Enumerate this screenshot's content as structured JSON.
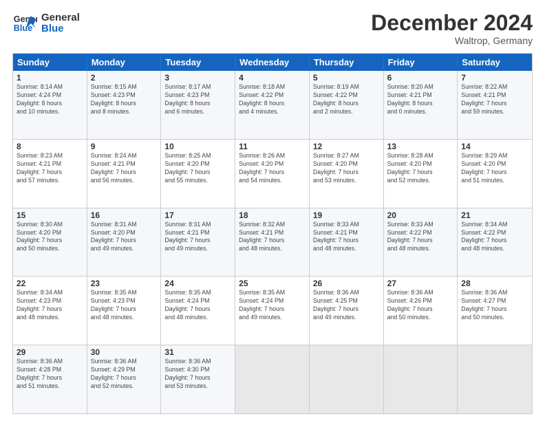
{
  "logo": {
    "line1": "General",
    "line2": "Blue"
  },
  "title": "December 2024",
  "subtitle": "Waltrop, Germany",
  "days_of_week": [
    "Sunday",
    "Monday",
    "Tuesday",
    "Wednesday",
    "Thursday",
    "Friday",
    "Saturday"
  ],
  "weeks": [
    [
      {
        "day": 1,
        "sunrise": "8:14 AM",
        "sunset": "4:24 PM",
        "daylight": "8 hours and 10 minutes."
      },
      {
        "day": 2,
        "sunrise": "8:15 AM",
        "sunset": "4:23 PM",
        "daylight": "8 hours and 8 minutes."
      },
      {
        "day": 3,
        "sunrise": "8:17 AM",
        "sunset": "4:23 PM",
        "daylight": "8 hours and 6 minutes."
      },
      {
        "day": 4,
        "sunrise": "8:18 AM",
        "sunset": "4:22 PM",
        "daylight": "8 hours and 4 minutes."
      },
      {
        "day": 5,
        "sunrise": "8:19 AM",
        "sunset": "4:22 PM",
        "daylight": "8 hours and 2 minutes."
      },
      {
        "day": 6,
        "sunrise": "8:20 AM",
        "sunset": "4:21 PM",
        "daylight": "8 hours and 0 minutes."
      },
      {
        "day": 7,
        "sunrise": "8:22 AM",
        "sunset": "4:21 PM",
        "daylight": "7 hours and 59 minutes."
      }
    ],
    [
      {
        "day": 8,
        "sunrise": "8:23 AM",
        "sunset": "4:21 PM",
        "daylight": "7 hours and 57 minutes."
      },
      {
        "day": 9,
        "sunrise": "8:24 AM",
        "sunset": "4:21 PM",
        "daylight": "7 hours and 56 minutes."
      },
      {
        "day": 10,
        "sunrise": "8:25 AM",
        "sunset": "4:20 PM",
        "daylight": "7 hours and 55 minutes."
      },
      {
        "day": 11,
        "sunrise": "8:26 AM",
        "sunset": "4:20 PM",
        "daylight": "7 hours and 54 minutes."
      },
      {
        "day": 12,
        "sunrise": "8:27 AM",
        "sunset": "4:20 PM",
        "daylight": "7 hours and 53 minutes."
      },
      {
        "day": 13,
        "sunrise": "8:28 AM",
        "sunset": "4:20 PM",
        "daylight": "7 hours and 52 minutes."
      },
      {
        "day": 14,
        "sunrise": "8:29 AM",
        "sunset": "4:20 PM",
        "daylight": "7 hours and 51 minutes."
      }
    ],
    [
      {
        "day": 15,
        "sunrise": "8:30 AM",
        "sunset": "4:20 PM",
        "daylight": "7 hours and 50 minutes."
      },
      {
        "day": 16,
        "sunrise": "8:31 AM",
        "sunset": "4:20 PM",
        "daylight": "7 hours and 49 minutes."
      },
      {
        "day": 17,
        "sunrise": "8:31 AM",
        "sunset": "4:21 PM",
        "daylight": "7 hours and 49 minutes."
      },
      {
        "day": 18,
        "sunrise": "8:32 AM",
        "sunset": "4:21 PM",
        "daylight": "7 hours and 48 minutes."
      },
      {
        "day": 19,
        "sunrise": "8:33 AM",
        "sunset": "4:21 PM",
        "daylight": "7 hours and 48 minutes."
      },
      {
        "day": 20,
        "sunrise": "8:33 AM",
        "sunset": "4:22 PM",
        "daylight": "7 hours and 48 minutes."
      },
      {
        "day": 21,
        "sunrise": "8:34 AM",
        "sunset": "4:22 PM",
        "daylight": "7 hours and 48 minutes."
      }
    ],
    [
      {
        "day": 22,
        "sunrise": "8:34 AM",
        "sunset": "4:23 PM",
        "daylight": "7 hours and 48 minutes."
      },
      {
        "day": 23,
        "sunrise": "8:35 AM",
        "sunset": "4:23 PM",
        "daylight": "7 hours and 48 minutes."
      },
      {
        "day": 24,
        "sunrise": "8:35 AM",
        "sunset": "4:24 PM",
        "daylight": "7 hours and 48 minutes."
      },
      {
        "day": 25,
        "sunrise": "8:35 AM",
        "sunset": "4:24 PM",
        "daylight": "7 hours and 49 minutes."
      },
      {
        "day": 26,
        "sunrise": "8:36 AM",
        "sunset": "4:25 PM",
        "daylight": "7 hours and 49 minutes."
      },
      {
        "day": 27,
        "sunrise": "8:36 AM",
        "sunset": "4:26 PM",
        "daylight": "7 hours and 50 minutes."
      },
      {
        "day": 28,
        "sunrise": "8:36 AM",
        "sunset": "4:27 PM",
        "daylight": "7 hours and 50 minutes."
      }
    ],
    [
      {
        "day": 29,
        "sunrise": "8:36 AM",
        "sunset": "4:28 PM",
        "daylight": "7 hours and 51 minutes."
      },
      {
        "day": 30,
        "sunrise": "8:36 AM",
        "sunset": "4:29 PM",
        "daylight": "7 hours and 52 minutes."
      },
      {
        "day": 31,
        "sunrise": "8:36 AM",
        "sunset": "4:30 PM",
        "daylight": "7 hours and 53 minutes."
      },
      null,
      null,
      null,
      null
    ]
  ]
}
